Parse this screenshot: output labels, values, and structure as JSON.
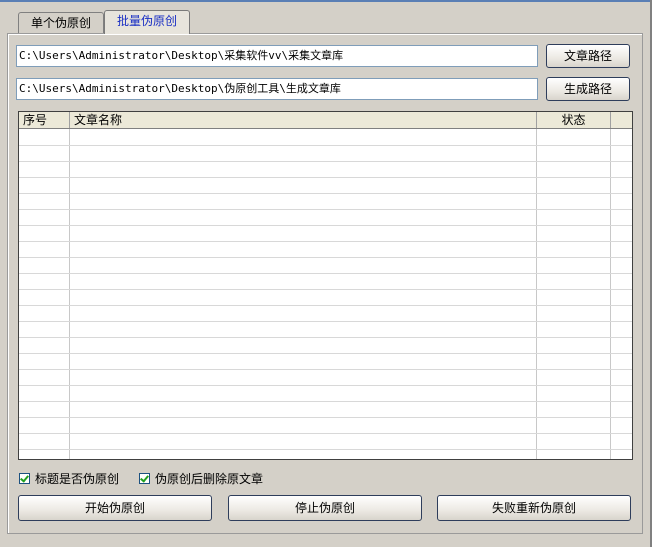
{
  "tabs": [
    {
      "label": "单个伪原创"
    },
    {
      "label": "批量伪原创"
    }
  ],
  "paths": {
    "source_value": "C:\\Users\\Administrator\\Desktop\\采集软件vv\\采集文章库",
    "source_button": "文章路径",
    "output_value": "C:\\Users\\Administrator\\Desktop\\伪原创工具\\生成文章库",
    "output_button": "生成路径"
  },
  "table": {
    "columns": [
      "序号",
      "文章名称",
      "状态",
      ""
    ],
    "rows": []
  },
  "options": {
    "title_rewrite": {
      "label": "标题是否伪原创",
      "checked": true
    },
    "delete_after": {
      "label": "伪原创后删除原文章",
      "checked": true
    }
  },
  "actions": {
    "start": "开始伪原创",
    "stop": "停止伪原创",
    "retry_failed": "失败重新伪原创"
  }
}
